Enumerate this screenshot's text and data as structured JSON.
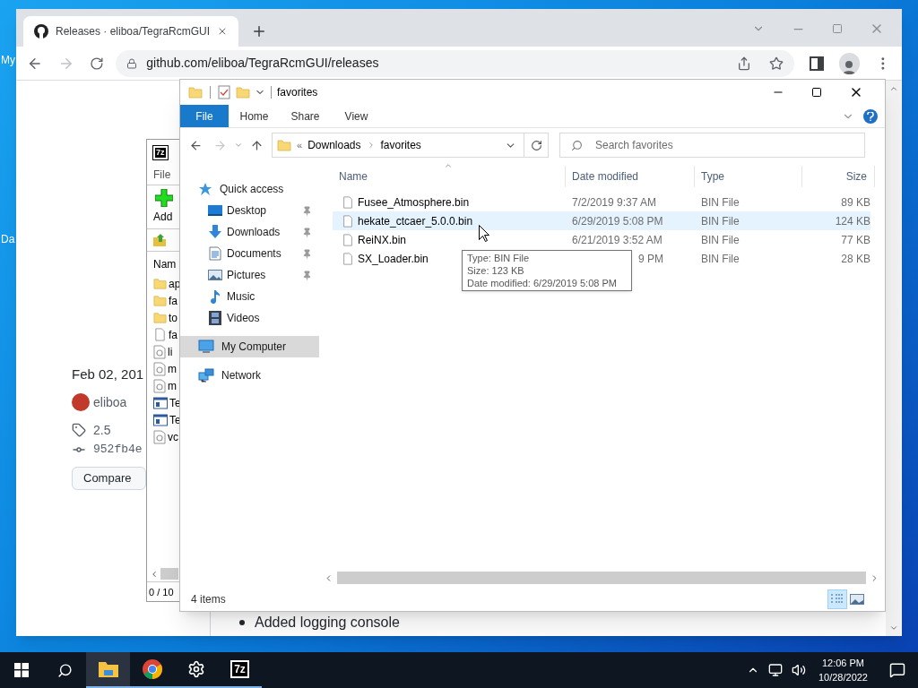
{
  "desktop": {
    "icon_labels": [
      "My",
      "Da"
    ]
  },
  "browser": {
    "tab": {
      "title": "Releases · eliboa/TegraRcmGUI"
    },
    "address": "github.com/eliboa/TegraRcmGUI/releases",
    "page": {
      "date": "Feb 02, 201",
      "author": "eliboa",
      "tag": "2.5",
      "commit": "952fb4e",
      "compare_button": "Compare",
      "notes": [
        "Added logging console"
      ]
    }
  },
  "archiver": {
    "icon_text": "7z",
    "menu": [
      "File"
    ],
    "toolbar": [
      "Add"
    ],
    "column": "Nam",
    "rows": [
      {
        "name": "ap",
        "kind": "folder"
      },
      {
        "name": "fa",
        "kind": "folder"
      },
      {
        "name": "to",
        "kind": "folder"
      },
      {
        "name": "fa",
        "kind": "file"
      },
      {
        "name": "li",
        "kind": "dll"
      },
      {
        "name": "m",
        "kind": "dll"
      },
      {
        "name": "m",
        "kind": "dll"
      },
      {
        "name": "Te",
        "kind": "app"
      },
      {
        "name": "Te",
        "kind": "app"
      },
      {
        "name": "vc",
        "kind": "dll"
      }
    ],
    "status": "0 / 10"
  },
  "explorer": {
    "title": "favorites",
    "ribbon_tabs": [
      {
        "label": "File",
        "selected": true
      },
      {
        "label": "Home",
        "selected": false
      },
      {
        "label": "Share",
        "selected": false
      },
      {
        "label": "View",
        "selected": false
      }
    ],
    "path_overflow": "«",
    "path": [
      "Downloads",
      "favorites"
    ],
    "search": {
      "placeholder": "Search favorites"
    },
    "nav": [
      {
        "label": "Quick access",
        "kind": "quick",
        "selected": false,
        "children": [
          {
            "label": "Desktop",
            "kind": "desktop",
            "pinned": true,
            "selected": false
          },
          {
            "label": "Downloads",
            "kind": "downloads",
            "pinned": true,
            "selected": false
          },
          {
            "label": "Documents",
            "kind": "documents",
            "pinned": true,
            "selected": false
          },
          {
            "label": "Pictures",
            "kind": "pictures",
            "pinned": true,
            "selected": false
          },
          {
            "label": "Music",
            "kind": "music",
            "pinned": false,
            "selected": false
          },
          {
            "label": "Videos",
            "kind": "videos",
            "pinned": false,
            "selected": false
          }
        ]
      },
      {
        "label": "My Computer",
        "kind": "computer",
        "selected": true
      },
      {
        "label": "Network",
        "kind": "network",
        "selected": false
      }
    ],
    "columns": [
      "Name",
      "Date modified",
      "Type",
      "Size"
    ],
    "files": [
      {
        "name": "Fusee_Atmosphere.bin",
        "date": "7/2/2019 9:37 AM",
        "type": "BIN File",
        "size": "89 KB",
        "hovered": false
      },
      {
        "name": "hekate_ctcaer_5.0.0.bin",
        "date": "6/29/2019 5:08 PM",
        "type": "BIN File",
        "size": "124 KB",
        "hovered": true,
        "tooltip": [
          "Type: BIN File",
          "Size: 123 KB",
          "Date modified: 6/29/2019 5:08 PM"
        ]
      },
      {
        "name": "ReiNX.bin",
        "date": "6/21/2019 3:52 AM",
        "type": "BIN File",
        "size": "77 KB",
        "hovered": false
      },
      {
        "name": "SX_Loader.bin",
        "date_partial": "9 PM",
        "type": "BIN File",
        "size": "28 KB",
        "hovered": false
      }
    ],
    "status": "4 items",
    "views": [
      {
        "kind": "details",
        "selected": true
      },
      {
        "kind": "thumbnails",
        "selected": false
      }
    ]
  },
  "taskbar": {
    "apps": [
      {
        "kind": "explorer",
        "active": true
      },
      {
        "kind": "chrome",
        "active": false
      },
      {
        "kind": "settings",
        "active": false
      },
      {
        "kind": "archiver",
        "active": false,
        "icon_text": "7z"
      }
    ],
    "time": "12:06 PM",
    "date": "10/28/2022"
  }
}
